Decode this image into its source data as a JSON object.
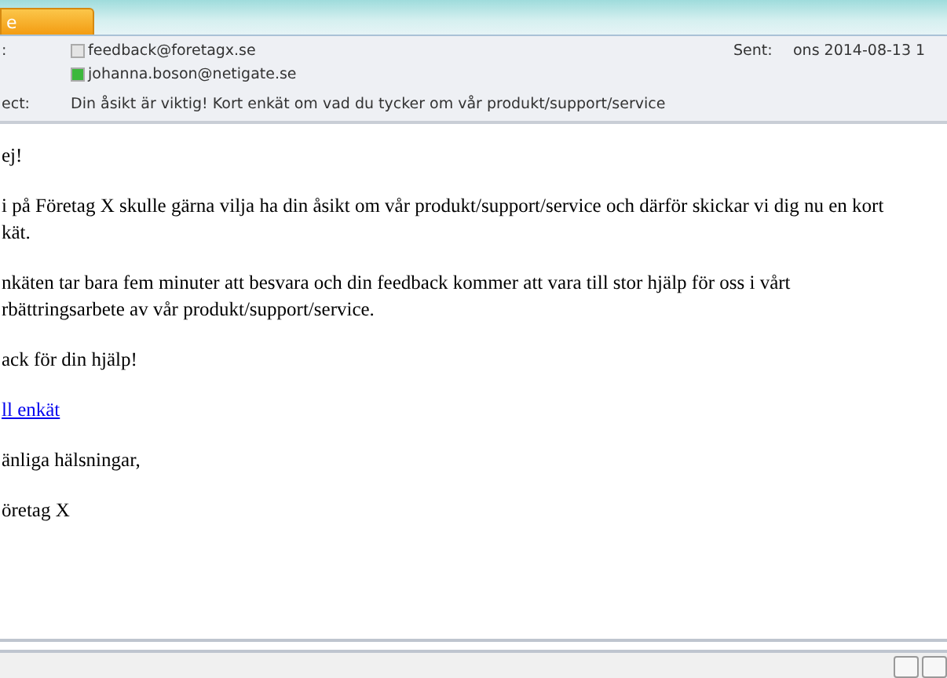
{
  "ribbon": {
    "tab": {
      "label": "e",
      "selected": true
    }
  },
  "header": {
    "from_label": ":",
    "recipients": [
      {
        "address": "feedback@foretagx.se",
        "color": "#e4e4e4"
      },
      {
        "address": "johanna.boson@netigate.se",
        "color": "#3cb83c"
      }
    ],
    "sent_label": "Sent:",
    "sent_value": "ons 2014-08-13 1",
    "subject_label": "ect:",
    "subject": "Din åsikt är viktig! Kort enkät om vad du tycker om vår produkt/support/service"
  },
  "body": [
    {
      "kind": "text",
      "text": "ej!"
    },
    {
      "kind": "text",
      "text": "i på Företag X skulle gärna vilja ha din åsikt om vår produkt/support/service och därför skickar vi dig nu en kort\nkät."
    },
    {
      "kind": "text",
      "text": "nkäten tar bara fem minuter att besvara och din feedback kommer att vara till stor hjälp för oss i vårt\nrbättringsarbete av vår produkt/support/service."
    },
    {
      "kind": "text",
      "text": "ack för din hjälp!"
    },
    {
      "kind": "link",
      "text": "ll enkät"
    },
    {
      "kind": "text",
      "text": "änliga hälsningar,"
    },
    {
      "kind": "text",
      "text": "öretag X"
    }
  ]
}
